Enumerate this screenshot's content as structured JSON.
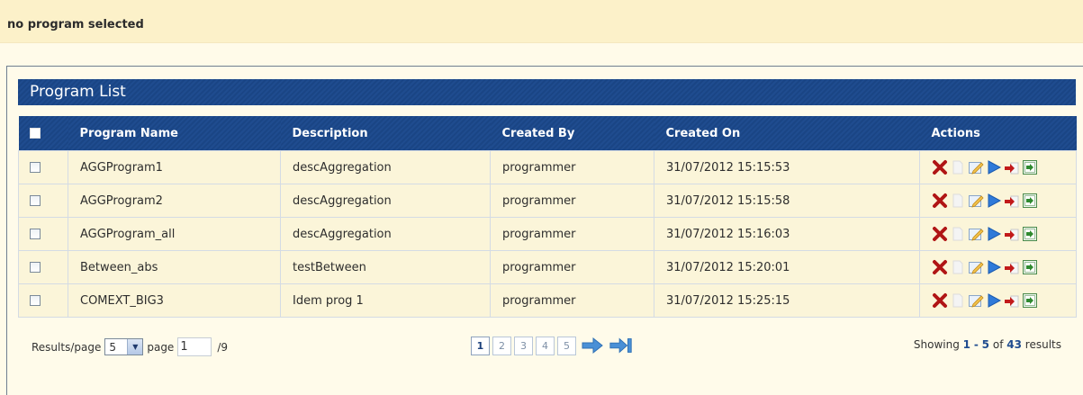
{
  "status": {
    "text": "no program selected"
  },
  "panel": {
    "title": "Program List"
  },
  "table": {
    "columns": [
      "Program Name",
      "Description",
      "Created By",
      "Created On",
      "Actions"
    ],
    "rows": [
      {
        "name": "AGGProgram1",
        "description": "descAggregation",
        "created_by": "programmer",
        "created_on": "31/07/2012 15:15:53"
      },
      {
        "name": "AGGProgram2",
        "description": "descAggregation",
        "created_by": "programmer",
        "created_on": "31/07/2012 15:15:58"
      },
      {
        "name": "AGGProgram_all",
        "description": "descAggregation",
        "created_by": "programmer",
        "created_on": "31/07/2012 15:16:03"
      },
      {
        "name": "Between_abs",
        "description": "testBetween",
        "created_by": "programmer",
        "created_on": "31/07/2012 15:20:01"
      },
      {
        "name": "COMEXT_BIG3",
        "description": "Idem prog 1",
        "created_by": "programmer",
        "created_on": "31/07/2012 15:25:15"
      }
    ],
    "action_icons": [
      "delete-icon",
      "blank-page-icon",
      "edit-icon",
      "run-icon",
      "export-icon",
      "import-icon"
    ]
  },
  "pager": {
    "results_label": "Results/page",
    "per_page": "5",
    "page_label": "page",
    "page_value": "1",
    "total_pages": "/9",
    "pages": [
      "1",
      "2",
      "3",
      "4",
      "5"
    ],
    "current_page": "1",
    "showing_prefix": "Showing",
    "range_start": "1",
    "range_sep": "-",
    "range_end": "5",
    "of_label": "of",
    "total": "43",
    "results_suffix": "results"
  }
}
